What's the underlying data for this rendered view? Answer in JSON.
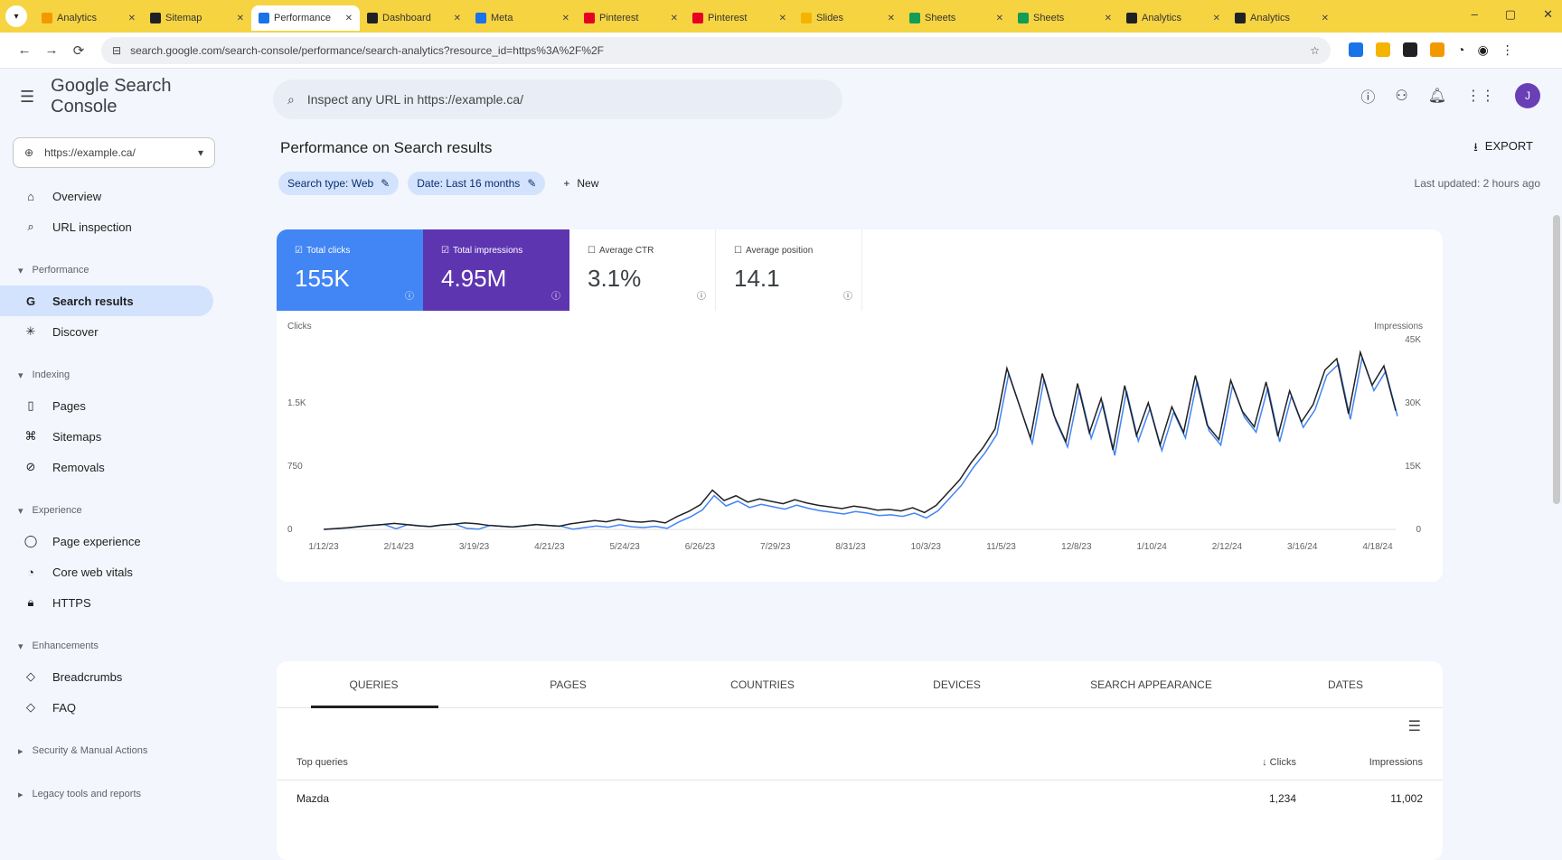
{
  "browser": {
    "tabs": [
      {
        "title": "Analytics",
        "color": "#f29900"
      },
      {
        "title": "Sitemap",
        "color": "#202124"
      },
      {
        "title": "Performance",
        "color": "#1a73e8",
        "active": true
      },
      {
        "title": "Dashboard",
        "color": "#202124"
      },
      {
        "title": "Meta",
        "color": "#1a73e8"
      },
      {
        "title": "Pinterest",
        "color": "#e60023"
      },
      {
        "title": "Pinterest",
        "color": "#e60023"
      },
      {
        "title": "Slides",
        "color": "#f4b400"
      },
      {
        "title": "Sheets",
        "color": "#0f9d58"
      },
      {
        "title": "Sheets",
        "color": "#0f9d58"
      },
      {
        "title": "Analytics",
        "color": "#202124"
      },
      {
        "title": "Analytics",
        "color": "#202124"
      }
    ],
    "url": "search.google.com/search-console/performance/search-analytics?resource_id=https%3A%2F%2F",
    "win": {
      "min": "–",
      "max": "▢",
      "close": "✕"
    }
  },
  "app": {
    "name": "Google Search Console",
    "search_placeholder": "Inspect any URL in https://example.ca/",
    "property": "https://example.ca/",
    "avatar_initial": "J"
  },
  "nav": {
    "overview": "Overview",
    "url_inspection": "URL inspection",
    "performance_section": "Performance",
    "search_results": "Search results",
    "discover": "Discover",
    "indexing_section": "Indexing",
    "pages": "Pages",
    "sitemaps": "Sitemaps",
    "removals": "Removals",
    "experience_section": "Experience",
    "page_experience": "Page experience",
    "core_web_vitals": "Core web vitals",
    "https": "HTTPS",
    "enhancements_section": "Enhancements",
    "breadcrumbs": "Breadcrumbs",
    "faq": "FAQ",
    "security_section": "Security & Manual Actions",
    "legacy_section": "Legacy tools and reports"
  },
  "page": {
    "title": "Performance on Search results",
    "export": "EXPORT",
    "chip_search_type": "Search type: Web",
    "chip_date": "Date: Last 16 months",
    "new_filter": "New",
    "last_updated": "Last updated: 2 hours ago"
  },
  "metrics": {
    "clicks_label": "Total clicks",
    "clicks_value": "155K",
    "impr_label": "Total impressions",
    "impr_value": "4.95M",
    "ctr_label": "Average CTR",
    "ctr_value": "3.1%",
    "pos_label": "Average position",
    "pos_value": "14.1"
  },
  "chart_data": {
    "type": "line",
    "series": [
      {
        "name": "Clicks",
        "color": "#4285f4"
      },
      {
        "name": "Impressions",
        "color": "#202124"
      }
    ],
    "x_ticks": [
      "1/12/23",
      "2/14/23",
      "3/19/23",
      "4/21/23",
      "5/24/23",
      "6/26/23",
      "7/29/23",
      "8/31/23",
      "10/3/23",
      "11/5/23",
      "12/8/23",
      "1/10/24",
      "2/12/24",
      "3/16/24",
      "4/18/24"
    ],
    "left_axis_title": "Clicks",
    "left_ticks": [
      "0",
      "750",
      "1.5K"
    ],
    "right_axis_title": "Impressions",
    "right_ticks": [
      "0",
      "15K",
      "30K",
      "45K"
    ],
    "y_levels": [
      0,
      0.2,
      0.4,
      0.7,
      1.0,
      1.2,
      1.5,
      1.2,
      0.9,
      0.7,
      1.1,
      1.3,
      1.6,
      1.4,
      1.0,
      0.8,
      0.6,
      0.9,
      1.2,
      1.0,
      0.8,
      1.4,
      1.8,
      2.2,
      1.9,
      2.5,
      2.0,
      1.8,
      2.1,
      1.6,
      3.2,
      4.5,
      6.2,
      9.8,
      7.2,
      8.4,
      6.8,
      7.6,
      7.0,
      6.4,
      7.4,
      6.6,
      6.0,
      5.6,
      5.2,
      5.8,
      5.4,
      4.8,
      5.0,
      4.6,
      5.4,
      4.2,
      6.0,
      9.2,
      12.4,
      16.8,
      20.5,
      25.1,
      40.2,
      31.5,
      22.8,
      38.9,
      28.4,
      21.9,
      36.4,
      24.1,
      32.7,
      19.8,
      35.9,
      23.4,
      31.6,
      21.0,
      30.6,
      24.2,
      38.4,
      26.0,
      22.4,
      37.2,
      29.4,
      25.6,
      36.8,
      23.2,
      34.6,
      26.8,
      31.2,
      39.8,
      42.6,
      28.8,
      44.2,
      36.0,
      40.8,
      29.6
    ]
  },
  "table": {
    "tabs": [
      "QUERIES",
      "PAGES",
      "COUNTRIES",
      "DEVICES",
      "SEARCH APPEARANCE",
      "DATES"
    ],
    "col_query": "Top queries",
    "col_clicks": "Clicks",
    "col_impr": "Impressions",
    "rows": [
      {
        "query": "Mazda",
        "clicks": "1,234",
        "impressions": "11,002"
      }
    ]
  }
}
